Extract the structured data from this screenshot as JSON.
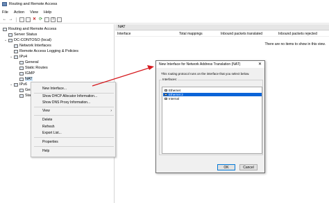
{
  "window": {
    "title": "Routing and Remote Access"
  },
  "menu": [
    "File",
    "Action",
    "View",
    "Help"
  ],
  "toolbar": [
    "back-icon",
    "forward-icon",
    "console-tree-icon",
    "properties-icon",
    "delete-icon",
    "refresh-icon",
    "export-icon",
    "help-icon",
    "action-icon"
  ],
  "tree": {
    "root": "Routing and Remote Access",
    "server_status": "Server Status",
    "server": "DC-CONTOSO (local)",
    "network_interfaces": "Network Interfaces",
    "remote_access_logging": "Remote Access Logging & Policies",
    "ipv4": "IPv4",
    "general": "General",
    "static_routes": "Static Routes",
    "igmp": "IGMP",
    "nat": "NAT",
    "ipv6": "IPv6",
    "ipv6_general": "Ger",
    "ipv6_static": "Sta"
  },
  "right": {
    "header": "NAT",
    "columns": [
      "Interface",
      "Total mappings",
      "Inbound packets translated",
      "Inbound packets rejected"
    ],
    "empty_message": "There are no items to show in this view."
  },
  "context_menu": {
    "new_interface": "New Interface...",
    "show_dhcp": "Show DHCP Allocator Information...",
    "show_dns": "Show DNS Proxy Information...",
    "view": "View",
    "delete": "Delete",
    "refresh": "Refresh",
    "export": "Export List...",
    "properties": "Properties",
    "help": "Help"
  },
  "dialog": {
    "title": "New Interface for Network Address Translation (NAT)",
    "close": "✕",
    "description": "This routing protocol runs on the interface that you select below.",
    "group_label": "Interfaces:",
    "interfaces": [
      "Ethernet",
      "Ethernet 2",
      "Internal"
    ],
    "selected_interface": "Ethernet 2",
    "ok": "OK",
    "cancel": "Cancel"
  },
  "colors": {
    "arrow": "#d61a1f",
    "selection": "#0a64d8"
  }
}
